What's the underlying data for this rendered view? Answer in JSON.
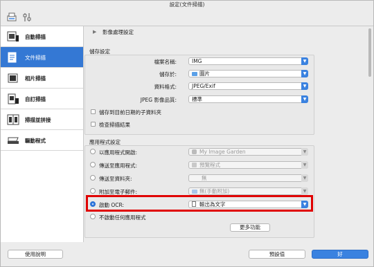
{
  "window": {
    "title": "設定(文件掃描)"
  },
  "toolbar": {
    "icons": [
      "scan-settings-icon",
      "general-settings-icon"
    ]
  },
  "sidebar": {
    "items": [
      {
        "label": "自動掃描",
        "icon": "auto-scan-icon",
        "active": false
      },
      {
        "label": "文件掃描",
        "icon": "document-scan-icon",
        "active": true
      },
      {
        "label": "相片掃描",
        "icon": "photo-scan-icon",
        "active": false
      },
      {
        "label": "自訂掃描",
        "icon": "custom-scan-icon",
        "active": false
      },
      {
        "label": "掃描並拼接",
        "icon": "scan-stitch-icon",
        "active": false
      },
      {
        "label": "驅動程式",
        "icon": "driver-icon",
        "active": false
      }
    ]
  },
  "main": {
    "image_processing": {
      "label": "影像處理設定"
    },
    "save_settings": {
      "heading": "儲存設定",
      "file_name_label": "檔案名稱:",
      "file_name_value": "IMG",
      "save_in_label": "儲存於:",
      "save_in_value": "圖片",
      "data_format_label": "資料格式:",
      "data_format_value": "JPEG/Exif",
      "jpeg_quality_label": "JPEG 影像品質:",
      "jpeg_quality_value": "標準",
      "subfolder_label": "儲存到目前日期的子資料夾",
      "check_results_label": "檢查掃描結果"
    },
    "app_settings": {
      "heading": "應用程式設定",
      "options": [
        {
          "label": "以應用程式開啟:",
          "value": "My Image Garden",
          "selected": false
        },
        {
          "label": "傳送至應用程式:",
          "value": "預覽程式",
          "selected": false
        },
        {
          "label": "傳送至資料夾:",
          "value": "無",
          "selected": false
        },
        {
          "label": "附加至電子郵件:",
          "value": "無(手動附加)",
          "selected": false
        },
        {
          "label": "啟動 OCR:",
          "value": "輸出為文字",
          "selected": true
        }
      ],
      "none_label": "不啟動任何應用程式",
      "more_functions": "更多功能"
    }
  },
  "footer": {
    "help": "使用說明",
    "defaults": "預設值",
    "ok": "好"
  },
  "colors": {
    "accent": "#3478d4",
    "highlight": "#e00000"
  }
}
